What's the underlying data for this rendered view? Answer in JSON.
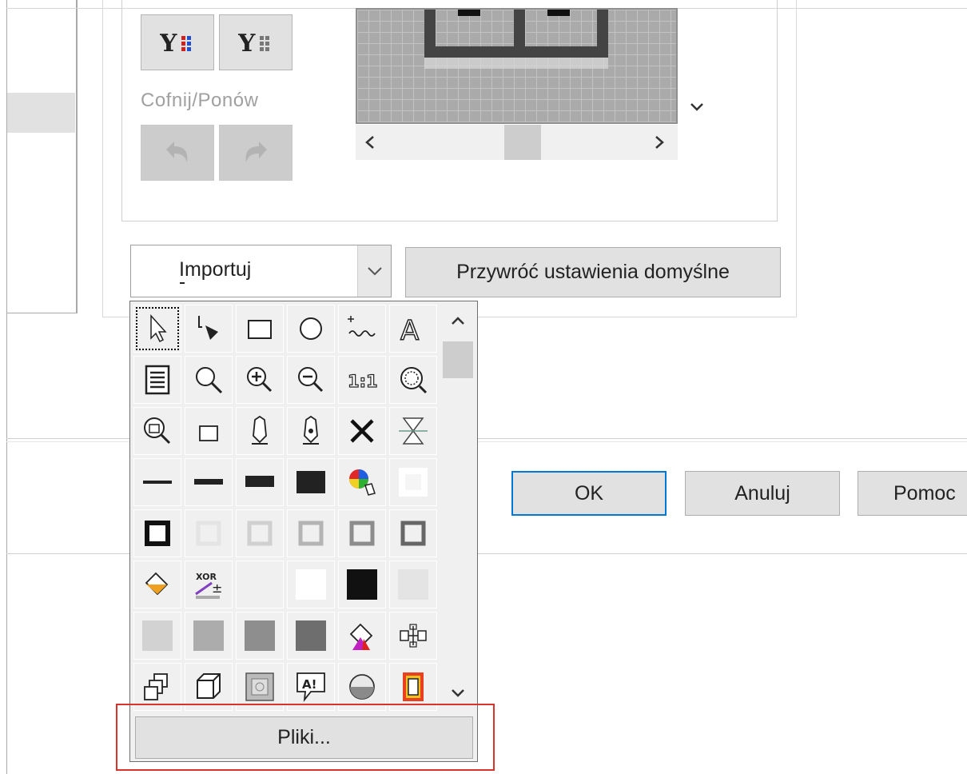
{
  "undo_redo": {
    "label": "Cofnij/Ponów",
    "undo_icon": "undo-icon",
    "redo_icon": "redo-icon"
  },
  "top_buttons": [
    {
      "icon": "filter-color-icon"
    },
    {
      "icon": "filter-gray-icon"
    }
  ],
  "import_combo": {
    "value": "Importuj",
    "icon": "chevron-down-icon"
  },
  "reset_button": {
    "label": "Przywróć ustawienia domyślne"
  },
  "dialog_buttons": {
    "ok": "OK",
    "cancel": "Anuluj",
    "help": "Pomoc"
  },
  "dropdown": {
    "files_button": "Pliki...",
    "icons": [
      [
        "select-arrow-icon",
        "shape-tool-icon",
        "rectangle-icon",
        "ellipse-icon",
        "freehand-icon",
        "text-icon"
      ],
      [
        "text-document-icon",
        "zoom-icon",
        "zoom-in-icon",
        "zoom-out-icon",
        "zoom-100-icon",
        "zoom-fit-icon"
      ],
      [
        "zoom-selection-icon",
        "small-rectangle-icon",
        "pen-icon",
        "pen-outline-icon",
        "close-icon",
        "hourglass-icon"
      ],
      [
        "line-thin-icon",
        "line-medium-icon",
        "line-thick-icon",
        "line-heavy-icon",
        "color-wheel-icon",
        "white-swatch-icon"
      ],
      [
        "outline-black-icon",
        "outline-light-icon",
        "outline-gray-light-icon",
        "outline-gray-icon",
        "outline-gray-dark-icon",
        "outline-dark-icon"
      ],
      [
        "fill-bucket-icon",
        "formula-icon",
        "empty-swatch-icon",
        "white-fill-icon",
        "black-fill-icon",
        "light-gray-fill-icon"
      ],
      [
        "gray-10-fill-icon",
        "gray-30-fill-icon",
        "gray-50-fill-icon",
        "gray-70-fill-icon",
        "fill-gradient-icon",
        "blend-icon"
      ],
      [
        "copy-icon",
        "cube-icon",
        "bevel-icon",
        "callout-icon",
        "sphere-icon",
        "frame-icon"
      ]
    ]
  },
  "colors": {
    "highlight": "#d9342b",
    "primary_border": "#0078d7"
  }
}
